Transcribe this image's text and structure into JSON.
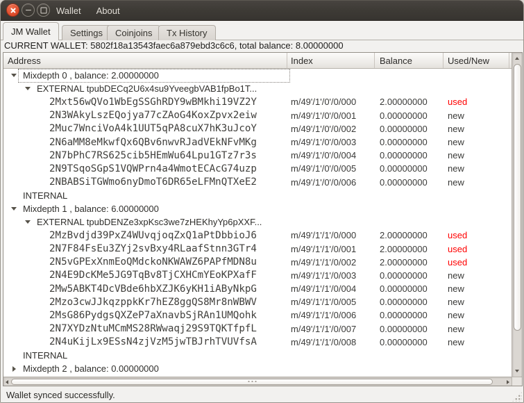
{
  "titlebar": {
    "menu_items": [
      {
        "label": "Wallet"
      },
      {
        "label": "About"
      }
    ]
  },
  "tabs": [
    {
      "label": "JM Wallet",
      "active": true
    },
    {
      "label": "Settings",
      "active": false
    },
    {
      "label": "Coinjoins",
      "active": false
    },
    {
      "label": "Tx History",
      "active": false
    }
  ],
  "current_wallet_line": "CURRENT WALLET: 5802f18a13543faec6a879ebd3c6c6, total balance: 8.00000000",
  "tree": {
    "columns": [
      "Address",
      "Index",
      "Balance",
      "Used/New"
    ],
    "rows": [
      {
        "kind": "mixdepth",
        "level": 0,
        "expander": "open",
        "focused": true,
        "address": "Mixdepth 0 , balance: 2.00000000",
        "index": "",
        "balance": "",
        "status": ""
      },
      {
        "kind": "branch",
        "level": 1,
        "expander": "open",
        "address": "EXTERNAL tpubDECq2U6x4su9YveegbVAB1fpBo1T...",
        "index": "",
        "balance": "",
        "status": ""
      },
      {
        "kind": "address",
        "level": 2,
        "expander": "none",
        "address": "2Mxt56wQVo1WbEgSSGhRDY9wBMkhi19VZ2Y",
        "index": "m/49'/1'/0'/0/000",
        "balance": "2.00000000",
        "status": "used"
      },
      {
        "kind": "address",
        "level": 2,
        "expander": "none",
        "address": "2N3WAkyLszEQojya77cZAoG4KoxZpvx2eiw",
        "index": "m/49'/1'/0'/0/001",
        "balance": "0.00000000",
        "status": "new"
      },
      {
        "kind": "address",
        "level": 2,
        "expander": "none",
        "address": "2Muc7WnciVoA4k1UUT5qPA8cuX7hK3uJcoY",
        "index": "m/49'/1'/0'/0/002",
        "balance": "0.00000000",
        "status": "new"
      },
      {
        "kind": "address",
        "level": 2,
        "expander": "none",
        "address": "2N6aMM8eMkwfQx6QBv6nwvRJadVEkNFvMKg",
        "index": "m/49'/1'/0'/0/003",
        "balance": "0.00000000",
        "status": "new"
      },
      {
        "kind": "address",
        "level": 2,
        "expander": "none",
        "address": "2N7bPhC7RS625cib5HEmWu64Lpu1GTz7r3s",
        "index": "m/49'/1'/0'/0/004",
        "balance": "0.00000000",
        "status": "new"
      },
      {
        "kind": "address",
        "level": 2,
        "expander": "none",
        "address": "2N9TSqoSGpS1VQWPrn4a4WmotECAcG74uzp",
        "index": "m/49'/1'/0'/0/005",
        "balance": "0.00000000",
        "status": "new"
      },
      {
        "kind": "address",
        "level": 2,
        "expander": "none",
        "address": "2NBABSiTGWmo6nyDmoT6DR65eLFMnQTXeE2",
        "index": "m/49'/1'/0'/0/006",
        "balance": "0.00000000",
        "status": "new"
      },
      {
        "kind": "branch",
        "level": 1,
        "expander": "none",
        "address": "INTERNAL",
        "index": "",
        "balance": "",
        "status": ""
      },
      {
        "kind": "mixdepth",
        "level": 0,
        "expander": "open",
        "address": "Mixdepth 1 , balance: 6.00000000",
        "index": "",
        "balance": "",
        "status": ""
      },
      {
        "kind": "branch",
        "level": 1,
        "expander": "open",
        "address": "EXTERNAL tpubDENZe3xpKsc3we7zHEKhyYp6pXXF...",
        "index": "",
        "balance": "",
        "status": ""
      },
      {
        "kind": "address",
        "level": 2,
        "expander": "none",
        "address": "2MzBvdjd39PxZ4WUvqjoqZxQ1aPtDbbioJ6",
        "index": "m/49'/1'/1'/0/000",
        "balance": "2.00000000",
        "status": "used"
      },
      {
        "kind": "address",
        "level": 2,
        "expander": "none",
        "address": "2N7F84FsEu3ZYj2svBxy4RLaafStnn3GTr4",
        "index": "m/49'/1'/1'/0/001",
        "balance": "2.00000000",
        "status": "used"
      },
      {
        "kind": "address",
        "level": 2,
        "expander": "none",
        "address": "2N5vGPExXnmEoQMdckoNKWAWZ6PAPfMDN8u",
        "index": "m/49'/1'/1'/0/002",
        "balance": "2.00000000",
        "status": "used"
      },
      {
        "kind": "address",
        "level": 2,
        "expander": "none",
        "address": "2N4E9DcKMe5JG9TqBv8TjCXHCmYEoKPXafF",
        "index": "m/49'/1'/1'/0/003",
        "balance": "0.00000000",
        "status": "new"
      },
      {
        "kind": "address",
        "level": 2,
        "expander": "none",
        "address": "2Mw5ABKT4DcVBde6hbXZJK6yKH1iAByNkpG",
        "index": "m/49'/1'/1'/0/004",
        "balance": "0.00000000",
        "status": "new"
      },
      {
        "kind": "address",
        "level": 2,
        "expander": "none",
        "address": "2Mzo3cwJJkqzppkKr7hEZ8ggQS8Mr8nWBWV",
        "index": "m/49'/1'/1'/0/005",
        "balance": "0.00000000",
        "status": "new"
      },
      {
        "kind": "address",
        "level": 2,
        "expander": "none",
        "address": "2MsG86PydgsQXZeP7aXnavbSjRAn1UMQohk",
        "index": "m/49'/1'/1'/0/006",
        "balance": "0.00000000",
        "status": "new"
      },
      {
        "kind": "address",
        "level": 2,
        "expander": "none",
        "address": "2N7XYDzNtuMCmMS28RWwaqj29S9TQKTfpfL",
        "index": "m/49'/1'/1'/0/007",
        "balance": "0.00000000",
        "status": "new"
      },
      {
        "kind": "address",
        "level": 2,
        "expander": "none",
        "address": "2N4uKijLx9ESsN4zjVzM5jwTBJrhTVUVfsA",
        "index": "m/49'/1'/1'/0/008",
        "balance": "0.00000000",
        "status": "new"
      },
      {
        "kind": "branch",
        "level": 1,
        "expander": "none",
        "address": "INTERNAL",
        "index": "",
        "balance": "",
        "status": ""
      },
      {
        "kind": "mixdepth",
        "level": 0,
        "expander": "closed",
        "address": "Mixdepth 2 , balance: 0.00000000",
        "index": "",
        "balance": "",
        "status": ""
      }
    ]
  },
  "status_bar": {
    "text": "Wallet synced successfully."
  },
  "colors": {
    "used_text": "#ff0000",
    "new_text": "#3a3a38",
    "close_button": "#e0502f",
    "titlebar_bg": "#3d3a35"
  }
}
